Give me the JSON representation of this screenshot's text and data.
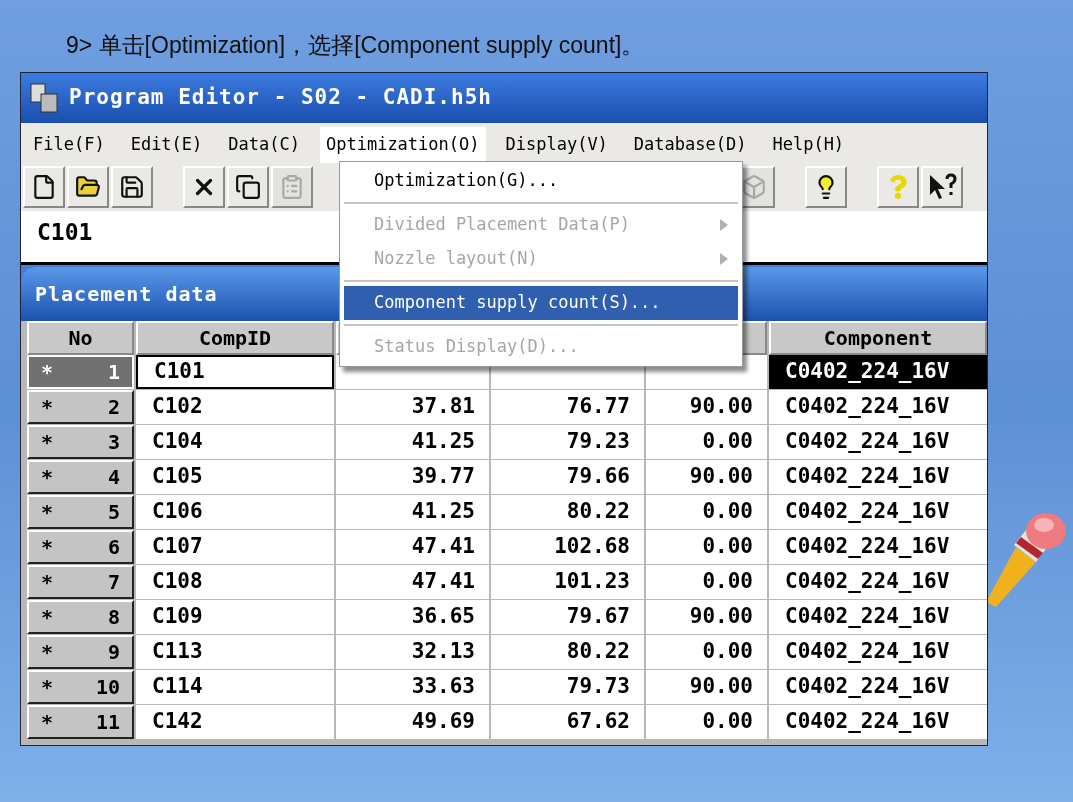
{
  "heading": "9> 单击[Optimization]，选择[Component supply count]。",
  "window": {
    "title": "Program Editor - S02 - CADI.h5h"
  },
  "menu_bar": [
    {
      "label": "File(F)",
      "selected": false
    },
    {
      "label": "Edit(E)",
      "selected": false
    },
    {
      "label": "Data(C)",
      "selected": false
    },
    {
      "label": "Optimization(O)",
      "selected": true
    },
    {
      "label": "Display(V)",
      "selected": false
    },
    {
      "label": "Database(D)",
      "selected": false
    },
    {
      "label": "Help(H)",
      "selected": false
    }
  ],
  "dropdown": [
    [
      {
        "label": "Optimization(G)...",
        "disabled": false,
        "submenu": false,
        "selected": false
      }
    ],
    [
      {
        "label": "Divided Placement Data(P)",
        "disabled": true,
        "submenu": true,
        "selected": false
      },
      {
        "label": "Nozzle layout(N)",
        "disabled": true,
        "submenu": true,
        "selected": false
      }
    ],
    [
      {
        "label": "Component supply count(S)...",
        "disabled": false,
        "submenu": false,
        "selected": true
      }
    ],
    [
      {
        "label": "Status Display(D)...",
        "disabled": true,
        "submenu": false,
        "selected": false
      }
    ]
  ],
  "toolbar": [
    [
      {
        "kind": "new",
        "disabled": false
      },
      {
        "kind": "open",
        "disabled": false
      },
      {
        "kind": "save",
        "disabled": false
      }
    ],
    [
      {
        "kind": "cut",
        "disabled": false
      },
      {
        "kind": "copy",
        "disabled": false
      },
      {
        "kind": "paste",
        "disabled": true
      }
    ],
    [
      {
        "kind": "box",
        "disabled": true
      }
    ],
    [
      {
        "kind": "bulb",
        "disabled": false
      }
    ],
    [
      {
        "kind": "help",
        "disabled": false
      },
      {
        "kind": "pointer_help",
        "disabled": false
      }
    ]
  ],
  "field": {
    "value": "C101"
  },
  "panel": {
    "title": "Placement data"
  },
  "table": {
    "columns": [
      "No",
      "CompID",
      null,
      null,
      null,
      "Component"
    ],
    "rows": [
      {
        "mark": "*",
        "no": "1",
        "comp_id": "C101",
        "component": "C0402_224_16V",
        "selected": true
      },
      {
        "mark": "*",
        "no": "2",
        "comp_id": "C102",
        "column_3": "37.81",
        "column_4": "76.77",
        "column_5": "90.00",
        "component": "C0402_224_16V",
        "selected": false
      },
      {
        "mark": "*",
        "no": "3",
        "comp_id": "C104",
        "column_3": "41.25",
        "column_4": "79.23",
        "column_5": "0.00",
        "component": "C0402_224_16V",
        "selected": false
      },
      {
        "mark": "*",
        "no": "4",
        "comp_id": "C105",
        "column_3": "39.77",
        "column_4": "79.66",
        "column_5": "90.00",
        "component": "C0402_224_16V",
        "selected": false
      },
      {
        "mark": "*",
        "no": "5",
        "comp_id": "C106",
        "column_3": "41.25",
        "column_4": "80.22",
        "column_5": "0.00",
        "component": "C0402_224_16V",
        "selected": false
      },
      {
        "mark": "*",
        "no": "6",
        "comp_id": "C107",
        "column_3": "47.41",
        "column_4": "102.68",
        "column_5": "0.00",
        "component": "C0402_224_16V",
        "selected": false
      },
      {
        "mark": "*",
        "no": "7",
        "comp_id": "C108",
        "column_3": "47.41",
        "column_4": "101.23",
        "column_5": "0.00",
        "component": "C0402_224_16V",
        "selected": false
      },
      {
        "mark": "*",
        "no": "8",
        "comp_id": "C109",
        "column_3": "36.65",
        "column_4": "79.67",
        "column_5": "90.00",
        "component": "C0402_224_16V",
        "selected": false
      },
      {
        "mark": "*",
        "no": "9",
        "comp_id": "C113",
        "column_3": "32.13",
        "column_4": "80.22",
        "column_5": "0.00",
        "component": "C0402_224_16V",
        "selected": false
      },
      {
        "mark": "*",
        "no": "10",
        "comp_id": "C114",
        "column_3": "33.63",
        "column_4": "79.73",
        "column_5": "90.00",
        "component": "C0402_224_16V",
        "selected": false
      },
      {
        "mark": "*",
        "no": "11",
        "comp_id": "C142",
        "column_3": "49.69",
        "column_4": "67.62",
        "column_5": "0.00",
        "component": "C0402_224_16V",
        "selected": false
      }
    ]
  }
}
